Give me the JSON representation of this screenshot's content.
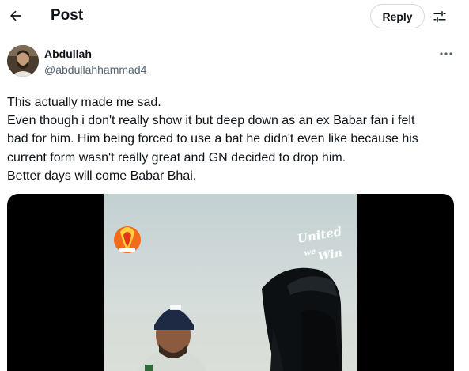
{
  "header": {
    "title": "Post",
    "reply_label": "Reply",
    "back_icon": "arrow-left-icon",
    "adjust_icon": "adjust-icon"
  },
  "post": {
    "author_name": "Abdullah",
    "author_handle": "@abdullahhammad4",
    "lines": [
      "This actually made me sad.",
      "Even though i don't really show it but deep down as an ex Babar fan i felt",
      "bad for him. Him being forced to use a bat he didn't even like because his",
      "current form wasn't really great and GN decided to drop him.",
      "Better days will come Babar Bhai."
    ]
  },
  "media": {
    "type": "video",
    "overlay_logo_text": [
      "United",
      "we",
      "Win"
    ]
  },
  "colors": {
    "text_primary": "#0f1419",
    "text_secondary": "#536471",
    "border": "#cfd9de",
    "media_background": "#000000"
  }
}
